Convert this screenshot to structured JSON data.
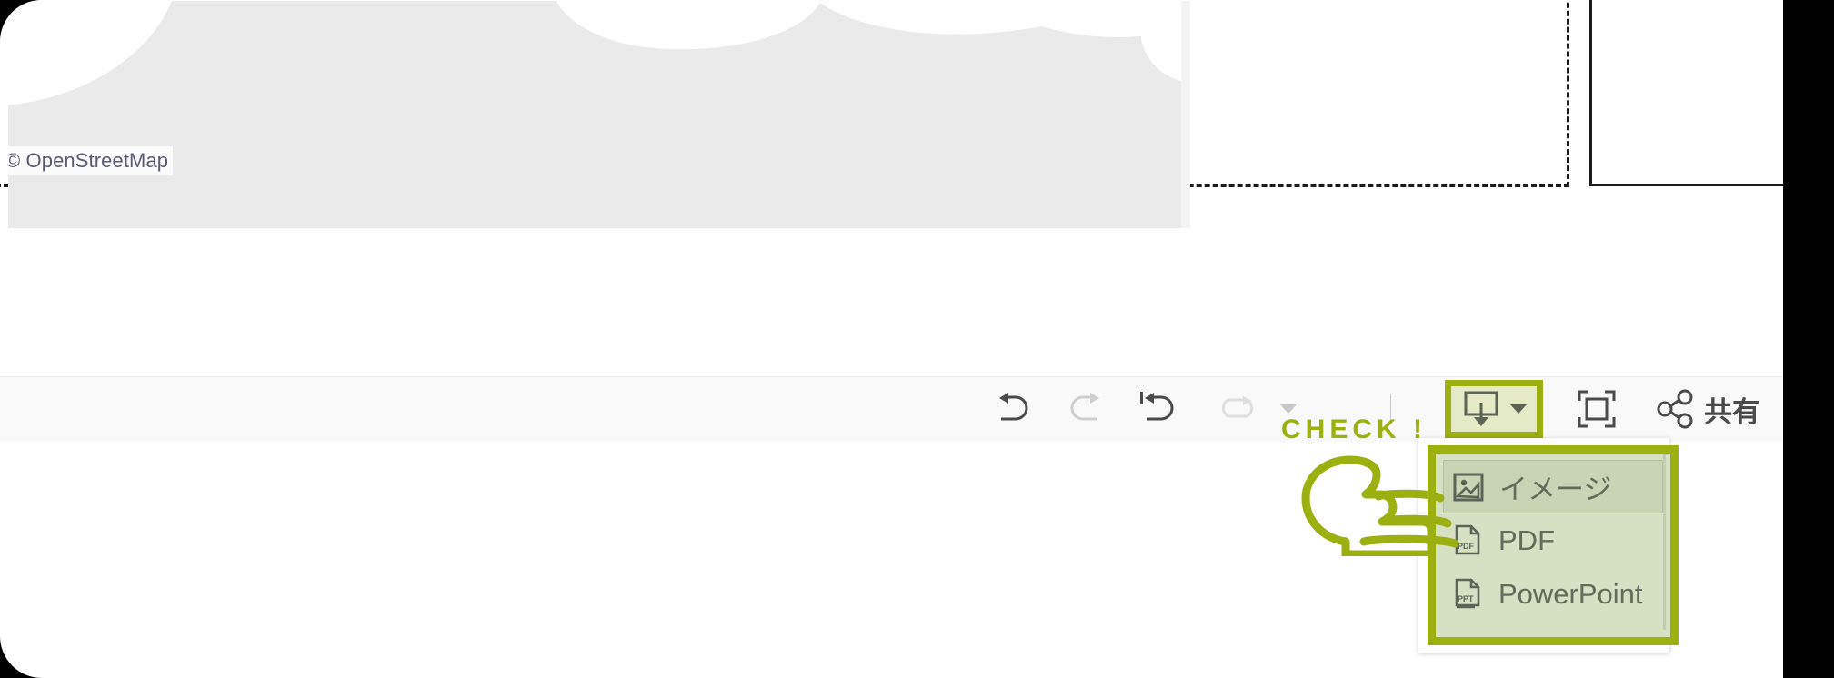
{
  "map": {
    "attribution": "© OpenStreetMap"
  },
  "toolbar": {
    "undo_label": "undo-arrow",
    "redo_label": "redo-arrow",
    "revert_label": "revert-to-start-arrow",
    "replay_label": "replay-arrow",
    "replay_caret": "▼",
    "export_label": "export",
    "export_caret": "▼",
    "fullscreen_label": "fullscreen",
    "share_label": "共有"
  },
  "annotation": {
    "check_text": "CHECK !"
  },
  "export_menu": {
    "items": [
      {
        "label": "イメージ",
        "icon": "image-icon",
        "selected": true
      },
      {
        "label": "PDF",
        "icon": "pdf-file-icon",
        "selected": false
      },
      {
        "label": "PowerPoint",
        "icon": "powerpoint-file-icon",
        "selected": false
      }
    ]
  },
  "colors": {
    "accent": "#9cb011",
    "menu_background": "#d6e0c2",
    "menu_selected": "#c8d4b3",
    "toolbar_background": "#f9f9f9",
    "map_sea": "#eaeaea",
    "gutter": "#000000"
  }
}
